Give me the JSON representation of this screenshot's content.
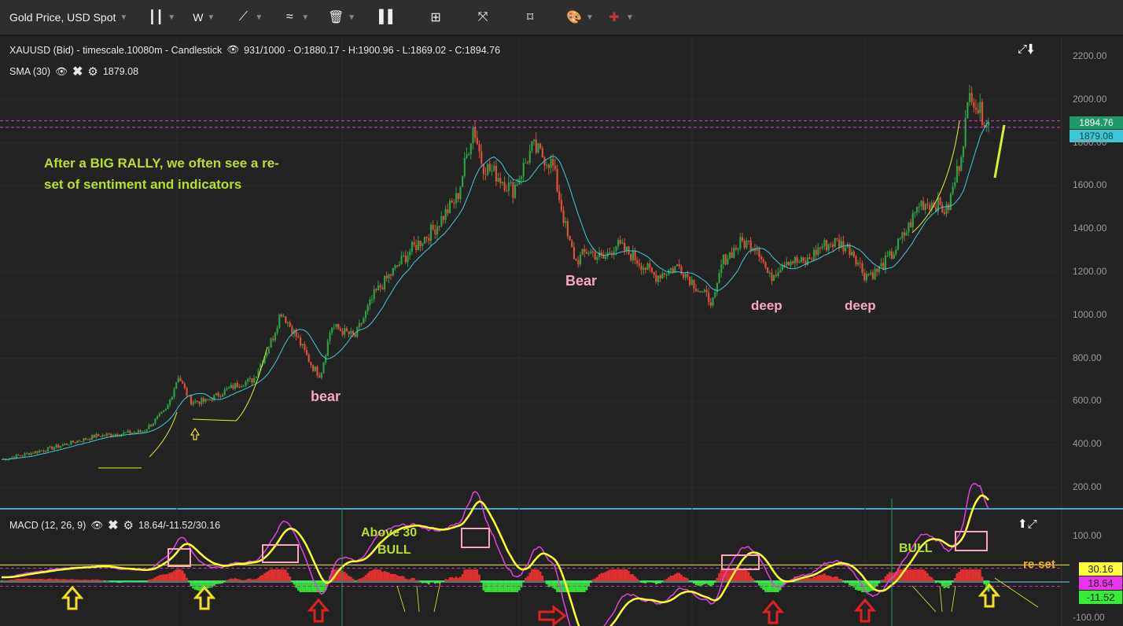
{
  "toolbar": {
    "symbol_label": "Gold Price, USD Spot",
    "timeframe": "W",
    "icons": [
      "candlestick-icon",
      "line-tool-icon",
      "indicator-icon",
      "trash-icon",
      "volume-icon",
      "layout-icon",
      "fullscreen-icon",
      "fit-icon",
      "palette-icon",
      "uk-flag-icon"
    ]
  },
  "legend": {
    "series": "XAUUSD (Bid) - timescale.10080m - Candlestick",
    "ohlc": "931/1000 - O:1880.17 - H:1900.96 - L:1869.02 - C:1894.76",
    "sma_label": "SMA (30)",
    "sma_value": "1879.08",
    "macd_label": "MACD (12, 26, 9)",
    "macd_values": "18.64/-11.52/30.16"
  },
  "price_tags": {
    "last": "1894.76",
    "sma": "1879.08"
  },
  "macd_tags": {
    "signal": "30.16",
    "macd": "18.64",
    "hist": "-11.52"
  },
  "annotations": {
    "rally_text_1": "After a BIG RALLY, we often see a re-",
    "rally_text_2": "set of sentiment and indicators",
    "bear_1": "bear",
    "bear_2": "Bear",
    "deep_1": "deep",
    "deep_2": "deep",
    "above30": "Above 30",
    "bull_1": "BULL",
    "bull_2": "BULL",
    "reset": "re-set"
  },
  "colors": {
    "up": "#2e9e45",
    "down": "#d9503a",
    "sma": "#40c8d8",
    "macd": "#e040e0",
    "signal": "#ffff30",
    "annot": "#b6e02a",
    "pink": "#f7a8c0"
  },
  "chart_data": {
    "type": "candlestick",
    "title": "XAUUSD (Bid) weekly",
    "ylim": [
      100,
      2300
    ],
    "yticks": [
      "2200.00",
      "2000.00",
      "1800.00",
      "1600.00",
      "1400.00",
      "1200.00",
      "1000.00",
      "800.00",
      "600.00",
      "400.00",
      "200.00"
    ],
    "macd_ylim": [
      -110,
      110
    ],
    "macd_yticks": [
      "100.00",
      "-100.00"
    ],
    "bars": 931,
    "sma_period": 30,
    "close_path": [
      [
        0,
        330
      ],
      [
        48,
        380
      ],
      [
        96,
        440
      ],
      [
        143,
        460
      ],
      [
        167,
        560
      ],
      [
        179,
        720
      ],
      [
        191,
        600
      ],
      [
        207,
        600
      ],
      [
        239,
        680
      ],
      [
        255,
        700
      ],
      [
        275,
        900
      ],
      [
        283,
        1020
      ],
      [
        299,
        900
      ],
      [
        315,
        760
      ],
      [
        323,
        720
      ],
      [
        334,
        950
      ],
      [
        358,
        900
      ],
      [
        378,
        1100
      ],
      [
        414,
        1300
      ],
      [
        438,
        1400
      ],
      [
        462,
        1550
      ],
      [
        478,
        1880
      ],
      [
        487,
        1700
      ],
      [
        502,
        1650
      ],
      [
        518,
        1580
      ],
      [
        538,
        1780
      ],
      [
        558,
        1700
      ],
      [
        574,
        1350
      ],
      [
        582,
        1250
      ],
      [
        594,
        1300
      ],
      [
        610,
        1260
      ],
      [
        622,
        1330
      ],
      [
        638,
        1280
      ],
      [
        662,
        1180
      ],
      [
        686,
        1230
      ],
      [
        710,
        1100
      ],
      [
        722,
        1060
      ],
      [
        730,
        1250
      ],
      [
        750,
        1340
      ],
      [
        766,
        1320
      ],
      [
        778,
        1170
      ],
      [
        794,
        1260
      ],
      [
        814,
        1240
      ],
      [
        830,
        1320
      ],
      [
        846,
        1340
      ],
      [
        862,
        1300
      ],
      [
        874,
        1190
      ],
      [
        886,
        1200
      ],
      [
        902,
        1280
      ],
      [
        918,
        1400
      ],
      [
        930,
        1520
      ],
      [
        946,
        1520
      ],
      [
        958,
        1480
      ],
      [
        970,
        1700
      ],
      [
        982,
        2050
      ],
      [
        990,
        1950
      ],
      [
        1000,
        1894.76
      ]
    ]
  }
}
